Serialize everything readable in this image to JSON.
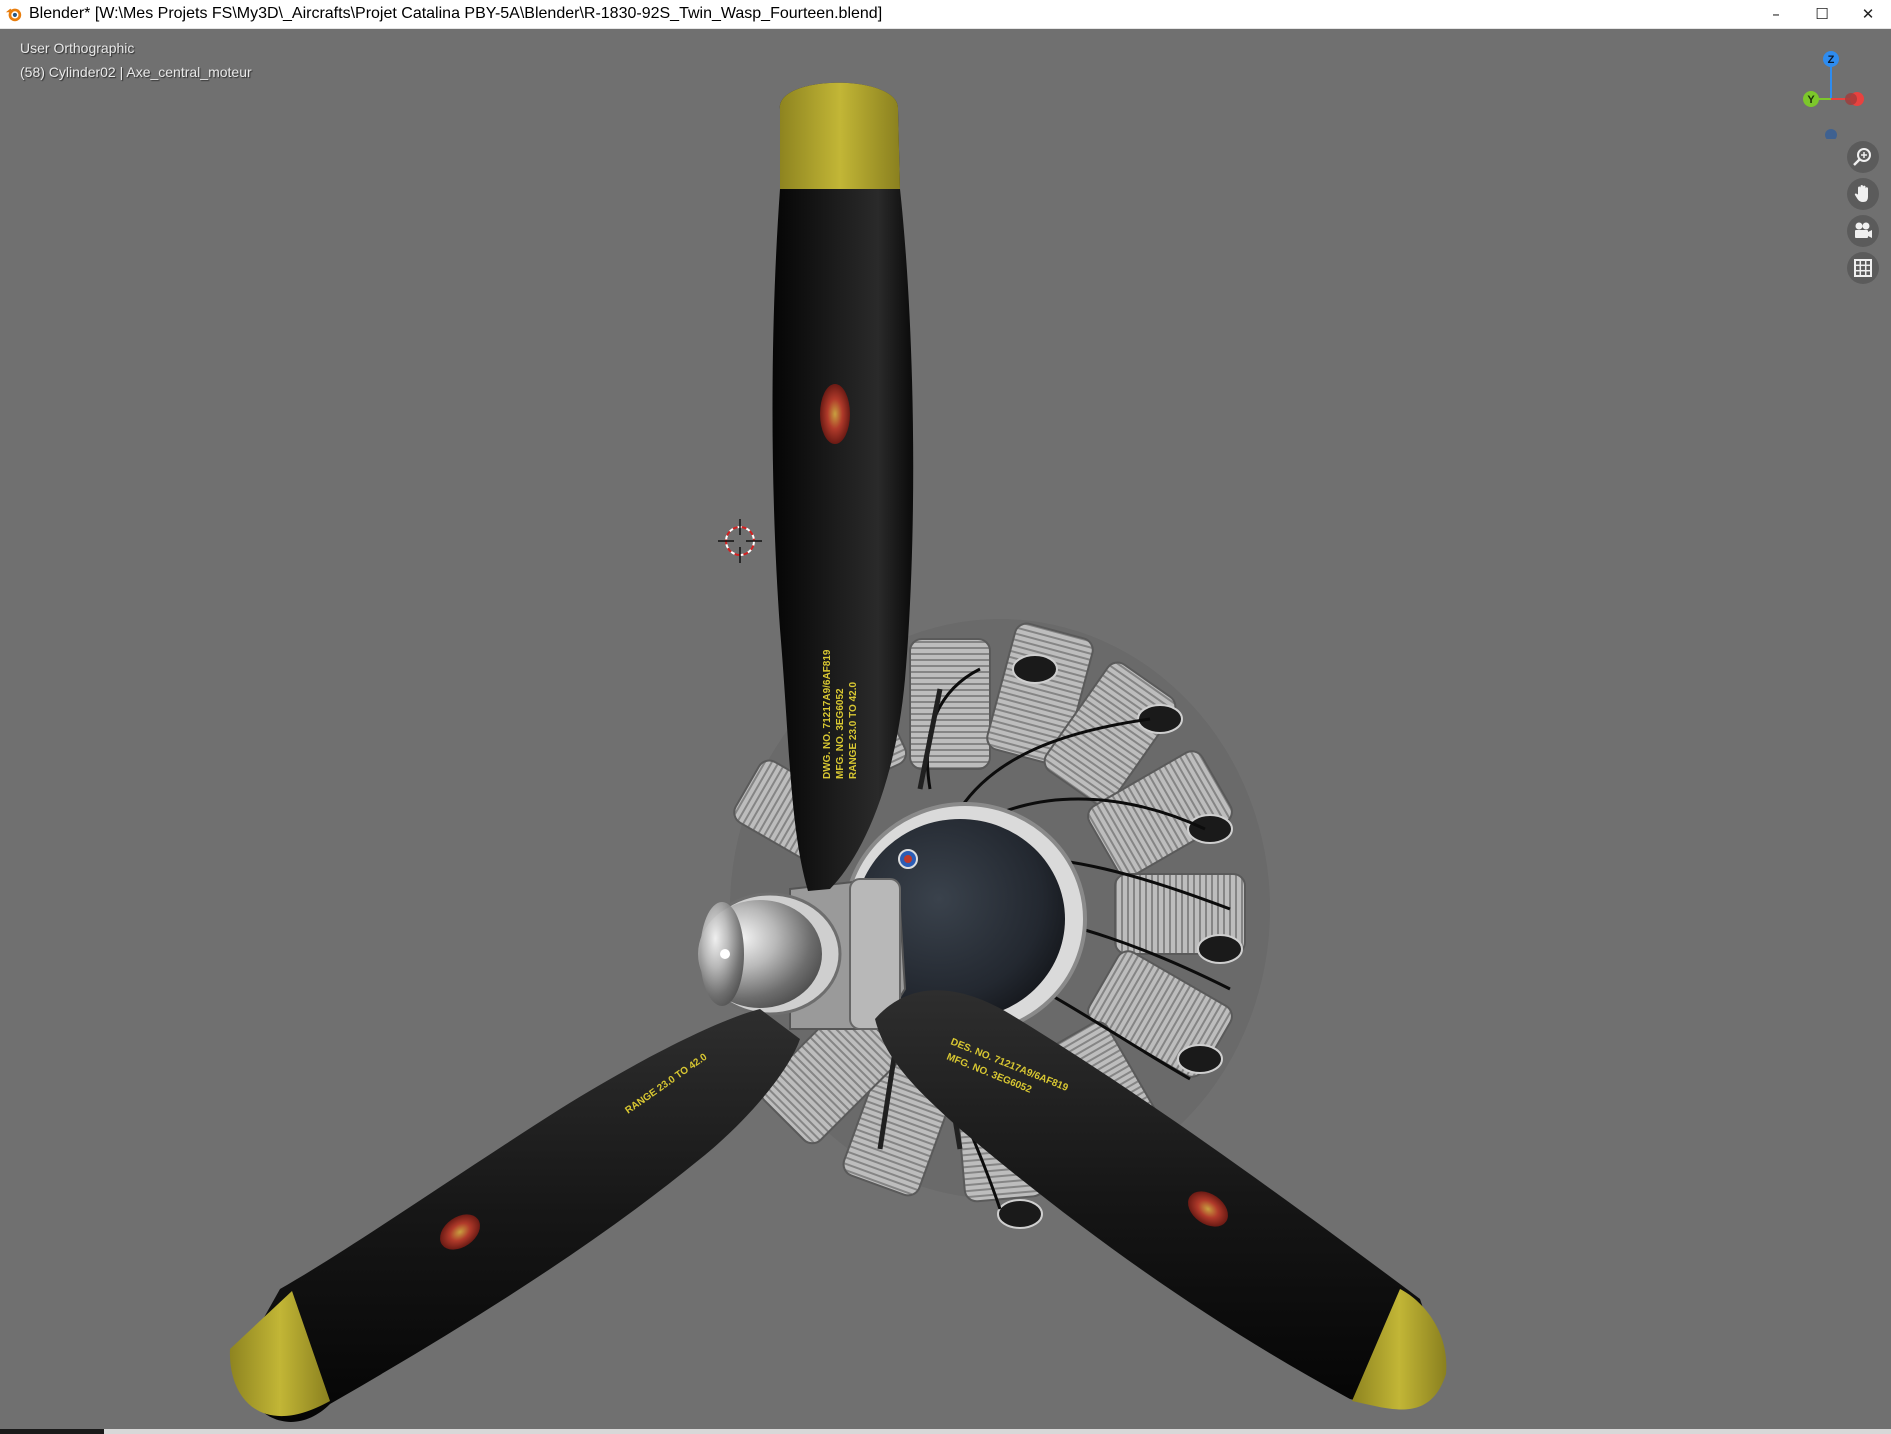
{
  "window": {
    "title": "Blender* [W:\\Mes Projets FS\\My3D\\_Aircrafts\\Projet Catalina PBY-5A\\Blender\\R-1830-92S_Twin_Wasp_Fourteen.blend]",
    "app_icon": "blender-logo-icon",
    "controls": {
      "minimize": "–",
      "maximize": "☐",
      "close": "✕"
    }
  },
  "viewport": {
    "view_name": "User Orthographic",
    "active_object": "(58) Cylinder02 | Axe_central_moteur",
    "background_color": "#707070"
  },
  "gizmo": {
    "z_label": "Z",
    "y_label": "Y",
    "colors": {
      "x": "#e8423f",
      "y": "#7cc72b",
      "z": "#2e8cf0"
    }
  },
  "nav_tools": [
    {
      "icon": "zoom-icon"
    },
    {
      "icon": "hand-pan-icon"
    },
    {
      "icon": "camera-icon"
    },
    {
      "icon": "grid-ortho-icon"
    }
  ],
  "blade_text": {
    "top_1": "DWG. NO. 71217A9/6AF819",
    "top_2": "MFG. NO. 3EG6052",
    "top_3": "RANGE 23.0 TO 42.0",
    "right_1": "DES. NO. 71217A9/6AF819",
    "right_2": "MFG. NO. 3EG6052",
    "left_1": "RANGE 23.0 TO 42.0"
  },
  "colors": {
    "blade": "#151515",
    "tip": "#b3a82a",
    "metal": "#c8c8c8",
    "hub_dark": "#2b3036"
  }
}
